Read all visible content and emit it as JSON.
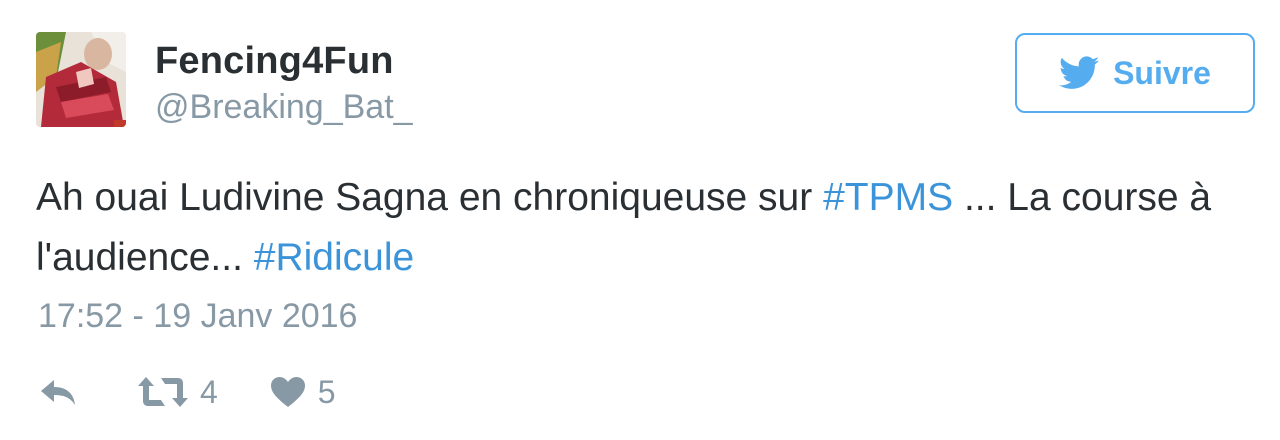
{
  "author": {
    "display_name": "Fencing4Fun",
    "handle": "@Breaking_Bat_",
    "avatar_icon": "profile-photo"
  },
  "follow_button": {
    "label": "Suivre",
    "icon": "twitter-bird-icon",
    "color": "#55acee"
  },
  "tweet": {
    "text_part1": "Ah ouai Ludivine Sagna en chroniqueuse sur ",
    "hashtag1": "#TPMS",
    "text_part2": " ... La course à l'audience... ",
    "hashtag2": "#Ridicule",
    "timestamp": "17:52 - 19 Janv 2016"
  },
  "actions": {
    "reply_icon": "reply-icon",
    "retweet_icon": "retweet-icon",
    "retweet_count": "4",
    "like_icon": "heart-icon",
    "like_count": "5"
  },
  "colors": {
    "text": "#292f33",
    "muted": "#8899a6",
    "link": "#3b94d9",
    "brand": "#55acee"
  }
}
